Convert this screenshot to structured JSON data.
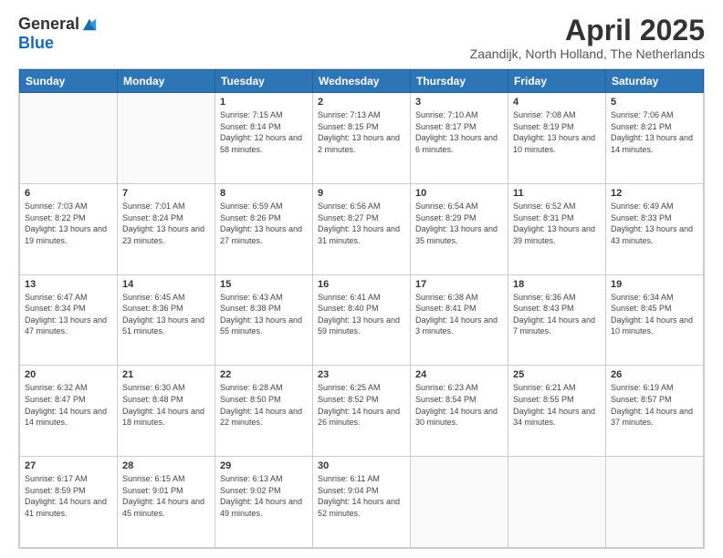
{
  "logo": {
    "general": "General",
    "blue": "Blue"
  },
  "title": "April 2025",
  "subtitle": "Zaandijk, North Holland, The Netherlands",
  "days_of_week": [
    "Sunday",
    "Monday",
    "Tuesday",
    "Wednesday",
    "Thursday",
    "Friday",
    "Saturday"
  ],
  "weeks": [
    [
      {
        "day": "",
        "info": ""
      },
      {
        "day": "",
        "info": ""
      },
      {
        "day": "1",
        "info": "Sunrise: 7:15 AM\nSunset: 8:14 PM\nDaylight: 12 hours and 58 minutes."
      },
      {
        "day": "2",
        "info": "Sunrise: 7:13 AM\nSunset: 8:15 PM\nDaylight: 13 hours and 2 minutes."
      },
      {
        "day": "3",
        "info": "Sunrise: 7:10 AM\nSunset: 8:17 PM\nDaylight: 13 hours and 6 minutes."
      },
      {
        "day": "4",
        "info": "Sunrise: 7:08 AM\nSunset: 8:19 PM\nDaylight: 13 hours and 10 minutes."
      },
      {
        "day": "5",
        "info": "Sunrise: 7:06 AM\nSunset: 8:21 PM\nDaylight: 13 hours and 14 minutes."
      }
    ],
    [
      {
        "day": "6",
        "info": "Sunrise: 7:03 AM\nSunset: 8:22 PM\nDaylight: 13 hours and 19 minutes."
      },
      {
        "day": "7",
        "info": "Sunrise: 7:01 AM\nSunset: 8:24 PM\nDaylight: 13 hours and 23 minutes."
      },
      {
        "day": "8",
        "info": "Sunrise: 6:59 AM\nSunset: 8:26 PM\nDaylight: 13 hours and 27 minutes."
      },
      {
        "day": "9",
        "info": "Sunrise: 6:56 AM\nSunset: 8:27 PM\nDaylight: 13 hours and 31 minutes."
      },
      {
        "day": "10",
        "info": "Sunrise: 6:54 AM\nSunset: 8:29 PM\nDaylight: 13 hours and 35 minutes."
      },
      {
        "day": "11",
        "info": "Sunrise: 6:52 AM\nSunset: 8:31 PM\nDaylight: 13 hours and 39 minutes."
      },
      {
        "day": "12",
        "info": "Sunrise: 6:49 AM\nSunset: 8:33 PM\nDaylight: 13 hours and 43 minutes."
      }
    ],
    [
      {
        "day": "13",
        "info": "Sunrise: 6:47 AM\nSunset: 8:34 PM\nDaylight: 13 hours and 47 minutes."
      },
      {
        "day": "14",
        "info": "Sunrise: 6:45 AM\nSunset: 8:36 PM\nDaylight: 13 hours and 51 minutes."
      },
      {
        "day": "15",
        "info": "Sunrise: 6:43 AM\nSunset: 8:38 PM\nDaylight: 13 hours and 55 minutes."
      },
      {
        "day": "16",
        "info": "Sunrise: 6:41 AM\nSunset: 8:40 PM\nDaylight: 13 hours and 59 minutes."
      },
      {
        "day": "17",
        "info": "Sunrise: 6:38 AM\nSunset: 8:41 PM\nDaylight: 14 hours and 3 minutes."
      },
      {
        "day": "18",
        "info": "Sunrise: 6:36 AM\nSunset: 8:43 PM\nDaylight: 14 hours and 7 minutes."
      },
      {
        "day": "19",
        "info": "Sunrise: 6:34 AM\nSunset: 8:45 PM\nDaylight: 14 hours and 10 minutes."
      }
    ],
    [
      {
        "day": "20",
        "info": "Sunrise: 6:32 AM\nSunset: 8:47 PM\nDaylight: 14 hours and 14 minutes."
      },
      {
        "day": "21",
        "info": "Sunrise: 6:30 AM\nSunset: 8:48 PM\nDaylight: 14 hours and 18 minutes."
      },
      {
        "day": "22",
        "info": "Sunrise: 6:28 AM\nSunset: 8:50 PM\nDaylight: 14 hours and 22 minutes."
      },
      {
        "day": "23",
        "info": "Sunrise: 6:25 AM\nSunset: 8:52 PM\nDaylight: 14 hours and 26 minutes."
      },
      {
        "day": "24",
        "info": "Sunrise: 6:23 AM\nSunset: 8:54 PM\nDaylight: 14 hours and 30 minutes."
      },
      {
        "day": "25",
        "info": "Sunrise: 6:21 AM\nSunset: 8:55 PM\nDaylight: 14 hours and 34 minutes."
      },
      {
        "day": "26",
        "info": "Sunrise: 6:19 AM\nSunset: 8:57 PM\nDaylight: 14 hours and 37 minutes."
      }
    ],
    [
      {
        "day": "27",
        "info": "Sunrise: 6:17 AM\nSunset: 8:59 PM\nDaylight: 14 hours and 41 minutes."
      },
      {
        "day": "28",
        "info": "Sunrise: 6:15 AM\nSunset: 9:01 PM\nDaylight: 14 hours and 45 minutes."
      },
      {
        "day": "29",
        "info": "Sunrise: 6:13 AM\nSunset: 9:02 PM\nDaylight: 14 hours and 49 minutes."
      },
      {
        "day": "30",
        "info": "Sunrise: 6:11 AM\nSunset: 9:04 PM\nDaylight: 14 hours and 52 minutes."
      },
      {
        "day": "",
        "info": ""
      },
      {
        "day": "",
        "info": ""
      },
      {
        "day": "",
        "info": ""
      }
    ]
  ],
  "colors": {
    "header_bg": "#2e75b6",
    "header_text": "#ffffff",
    "border": "#cccccc",
    "empty_bg": "#f9f9f9"
  }
}
